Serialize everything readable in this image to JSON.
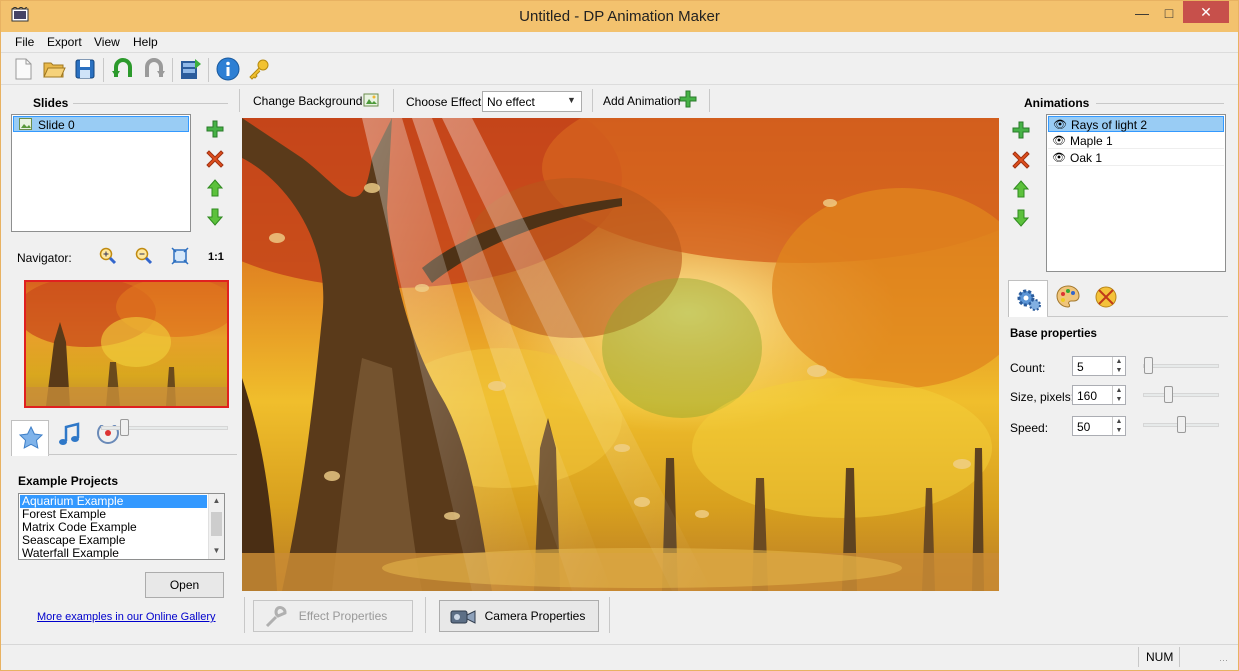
{
  "window": {
    "title": "Untitled - DP Animation Maker"
  },
  "menu": [
    "File",
    "Export",
    "View",
    "Help"
  ],
  "toolbar": {
    "items": [
      "new-file-icon",
      "open-folder-icon",
      "save-icon",
      "undo-icon",
      "redo-icon",
      "render-video-icon",
      "info-icon",
      "key-icon"
    ]
  },
  "slides": {
    "header": "Slides",
    "items": [
      "Slide 0"
    ]
  },
  "navigator": {
    "label": "Navigator:",
    "actual_size": "1:1"
  },
  "examples": {
    "header": "Example Projects",
    "items": [
      "Aquarium Example",
      "Forest Example",
      "Matrix Code Example",
      "Seascape Example",
      "Waterfall Example"
    ],
    "selected": "Aquarium Example",
    "open_label": "Open",
    "gallery_link": "More examples in our Online Gallery"
  },
  "canvas_toolbar": {
    "change_background": "Change Background",
    "choose_effect_label": "Choose Effect:",
    "effect_value": "No effect",
    "add_animation": "Add Animation"
  },
  "bottom": {
    "effect_properties": "Effect Properties",
    "camera_properties": "Camera Properties"
  },
  "animations": {
    "header": "Animations",
    "items": [
      "Rays of light 2",
      "Maple 1",
      "Oak 1"
    ],
    "selected": "Rays of light 2"
  },
  "properties": {
    "header": "Base properties",
    "count_label": "Count:",
    "count_value": "5",
    "size_label": "Size, pixels:",
    "size_value": "160",
    "speed_label": "Speed:",
    "speed_value": "50"
  },
  "status": {
    "num": "NUM"
  },
  "colors": {
    "title_bar": "#f3c26e",
    "selection": "#99ccf4",
    "slide_border": "#e02020",
    "link": "#0000cc"
  }
}
